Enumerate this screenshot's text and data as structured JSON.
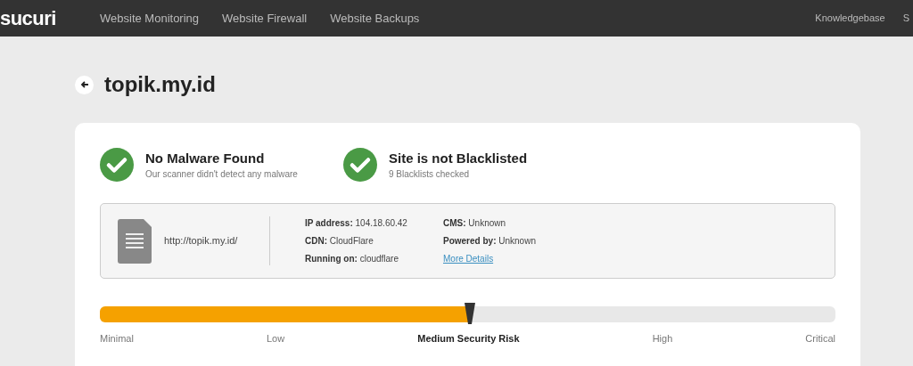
{
  "nav": {
    "logo": "sucuri",
    "links": [
      "Website Monitoring",
      "Website Firewall",
      "Website Backups"
    ],
    "right_links": [
      "Knowledgebase",
      "S"
    ]
  },
  "page_title": "topik.my.id",
  "checks": [
    {
      "title": "No Malware Found",
      "subtitle": "Our scanner didn't detect any malware",
      "passed": true
    },
    {
      "title": "Site is not Blacklisted",
      "subtitle": "9 Blacklists checked",
      "passed": true
    }
  ],
  "site_info": {
    "url": "http://topik.my.id/",
    "column_1": [
      {
        "label": "IP address:",
        "value": "104.18.60.42"
      },
      {
        "label": "CDN:",
        "value": "CloudFlare"
      },
      {
        "label": "Running on:",
        "value": "cloudflare"
      }
    ],
    "column_2": [
      {
        "label": "CMS:",
        "value": "Unknown"
      },
      {
        "label": "Powered by:",
        "value": "Unknown"
      }
    ],
    "link": "More Details"
  },
  "risk": {
    "level": 0.503,
    "labels": [
      {
        "text": "Minimal",
        "selected": false
      },
      {
        "text": "Low",
        "selected": false
      },
      {
        "text": "Medium Security Risk",
        "selected": true
      },
      {
        "text": "High",
        "selected": false
      },
      {
        "text": "Critical",
        "selected": false
      }
    ]
  }
}
